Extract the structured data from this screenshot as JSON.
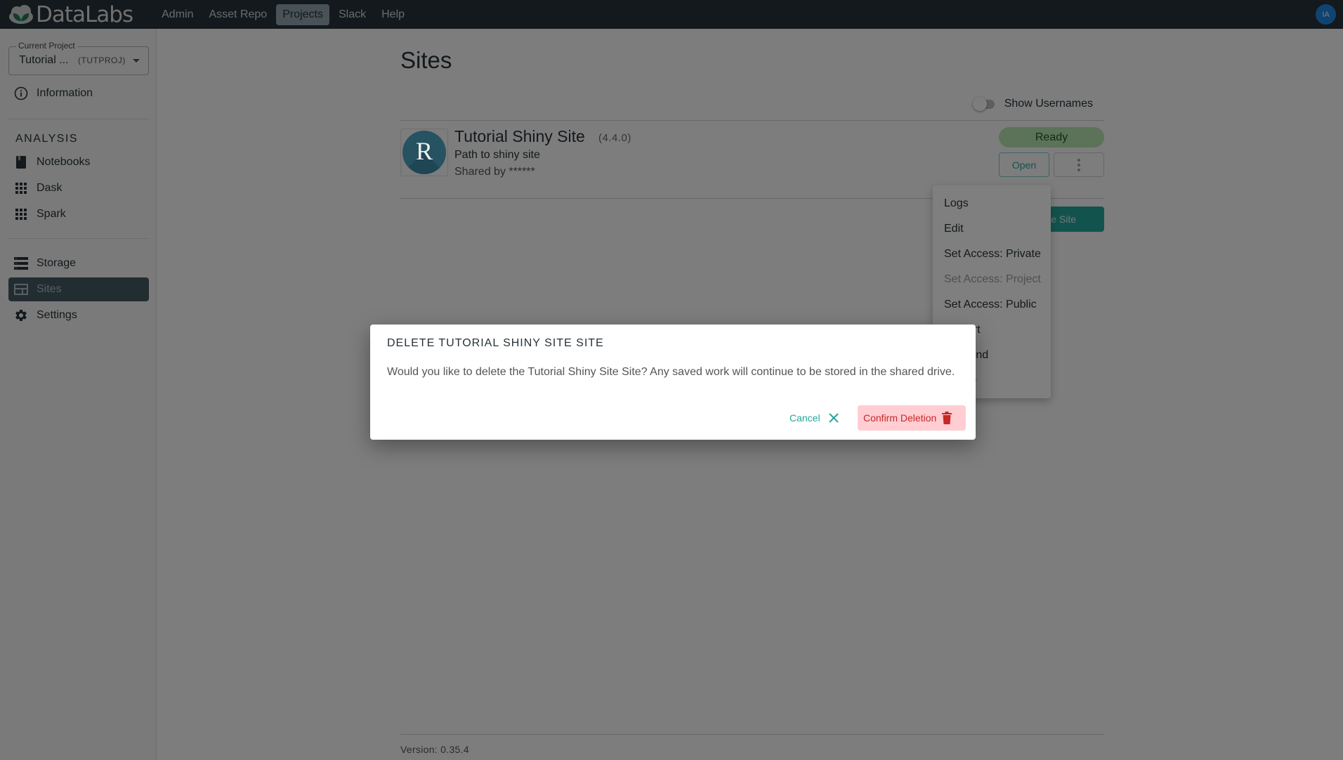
{
  "app": {
    "brand": "DataLabs",
    "colors": {
      "topbar": "#263238",
      "accent": "#26a69a",
      "ready": "#b9e4b3",
      "danger": "#c62828"
    }
  },
  "nav": {
    "items": [
      {
        "label": "Admin",
        "active": false
      },
      {
        "label": "Asset Repo",
        "active": false
      },
      {
        "label": "Projects",
        "active": true
      },
      {
        "label": "Slack",
        "active": false
      },
      {
        "label": "Help",
        "active": false
      }
    ],
    "user_initials": "IA"
  },
  "sidebar": {
    "project_select": {
      "label": "Current Project",
      "name": "Tutorial ...",
      "key": "(TUTPROJ)"
    },
    "info_item": {
      "label": "Information",
      "icon": "info-icon"
    },
    "analysis_heading": "ANALYSIS",
    "analysis_items": [
      {
        "label": "Notebooks",
        "icon": "notebook-icon"
      },
      {
        "label": "Dask",
        "icon": "grid-icon"
      },
      {
        "label": "Spark",
        "icon": "grid-icon"
      }
    ],
    "other_items": [
      {
        "label": "Storage",
        "icon": "storage-icon",
        "active": false
      },
      {
        "label": "Sites",
        "icon": "sites-icon",
        "active": true
      },
      {
        "label": "Settings",
        "icon": "gear-icon",
        "active": false
      }
    ]
  },
  "main": {
    "title": "Sites",
    "show_usernames_label": "Show Usernames",
    "show_usernames_on": false,
    "site": {
      "name": "Tutorial Shiny Site",
      "version": "(4.4.0)",
      "description": "Path to shiny site",
      "shared_by": "Shared by ******",
      "logo_letter": "R",
      "status": "Ready",
      "open_label": "Open"
    },
    "create_label": "Create Site",
    "version": "Version: 0.35.4"
  },
  "menu": {
    "items": [
      {
        "label": "Logs",
        "disabled": false
      },
      {
        "label": "Edit",
        "disabled": false
      },
      {
        "label": "Set Access: Private",
        "disabled": false
      },
      {
        "label": "Set Access: Project",
        "disabled": true
      },
      {
        "label": "Set Access: Public",
        "disabled": false
      },
      {
        "label": "Restart",
        "disabled": false
      },
      {
        "label": "Suspend",
        "disabled": false
      },
      {
        "label": "Delete",
        "disabled": false
      }
    ]
  },
  "dialog": {
    "title": "DELETE TUTORIAL SHINY SITE SITE",
    "body": "Would you like to delete the Tutorial Shiny Site Site? Any saved work will continue to be stored in the shared drive.",
    "cancel_label": "Cancel",
    "confirm_label": "Confirm Deletion"
  }
}
